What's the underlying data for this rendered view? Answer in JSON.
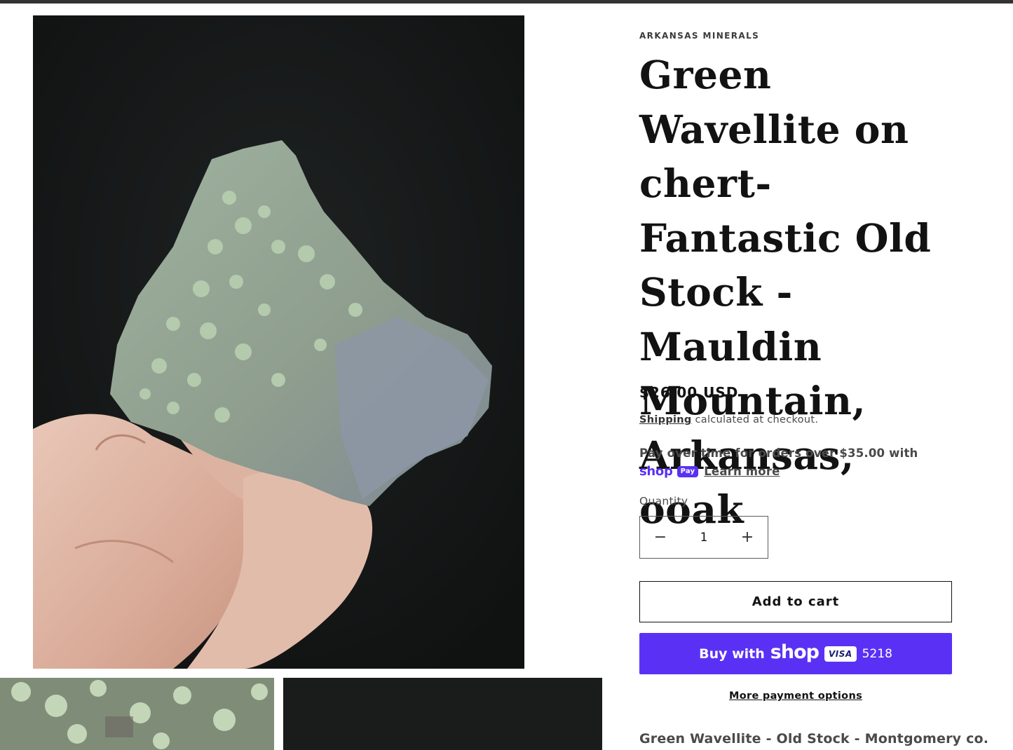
{
  "product": {
    "vendor": "ARKANSAS MINERALS",
    "title": "Green Wavellite on chert- Fantastic Old Stock - Mauldin Mountain, Arkansas, ooak",
    "price": "$26.00 USD",
    "shipping_link": "Shipping",
    "shipping_text": " calculated at checkout.",
    "installments_text": "Pay over time for orders over $35.00 with",
    "shop_logo": "shop",
    "pay_pill": "Pay",
    "learn_more": "Learn more",
    "quantity_label": "Quantity",
    "quantity_value": "1",
    "decrease_symbol": "−",
    "increase_symbol": "+",
    "add_to_cart": "Add to cart",
    "buy_with": "Buy with",
    "buy_shop": "shop",
    "card_brand": "VISA",
    "card_last4": "5218",
    "more_payment_options": "More payment options",
    "description_start": "Green Wavellite - Old Stock - Montgomery co."
  },
  "colors": {
    "shop_pay_purple": "#5a31f4",
    "text_dark": "#121212",
    "top_bar": "#333333"
  },
  "icons": [
    "minus-icon",
    "plus-icon",
    "shop-pay-logo",
    "visa-card-icon"
  ]
}
